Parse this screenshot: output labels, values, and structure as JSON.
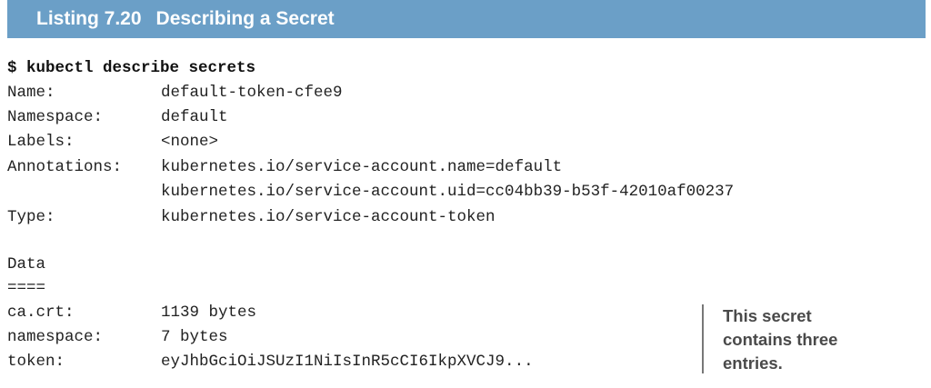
{
  "listing": {
    "number": "Listing 7.20",
    "title": "Describing a Secret"
  },
  "command": "$ kubectl describe secrets",
  "fields": [
    {
      "key": "Name:",
      "value": "default-token-cfee9"
    },
    {
      "key": "Namespace:",
      "value": "default"
    },
    {
      "key": "Labels:",
      "value": "<none>"
    },
    {
      "key": "Annotations:",
      "value": "kubernetes.io/service-account.name=default"
    },
    {
      "key": "",
      "value": "kubernetes.io/service-account.uid=cc04bb39-b53f-42010af00237"
    },
    {
      "key": "Type:",
      "value": "kubernetes.io/service-account-token"
    }
  ],
  "data_section": {
    "heading": "Data",
    "underline": "===="
  },
  "data_entries": [
    {
      "key": "ca.crt:",
      "value": "1139 bytes"
    },
    {
      "key": "namespace:",
      "value": "7 bytes"
    },
    {
      "key": "token:",
      "value": "eyJhbGciOiJSUzI1NiIsInR5cCI6IkpXVCJ9..."
    }
  ],
  "annotation": {
    "lines": [
      "This secret",
      "contains three",
      "entries."
    ],
    "accent_color": "#6b9fc7"
  }
}
